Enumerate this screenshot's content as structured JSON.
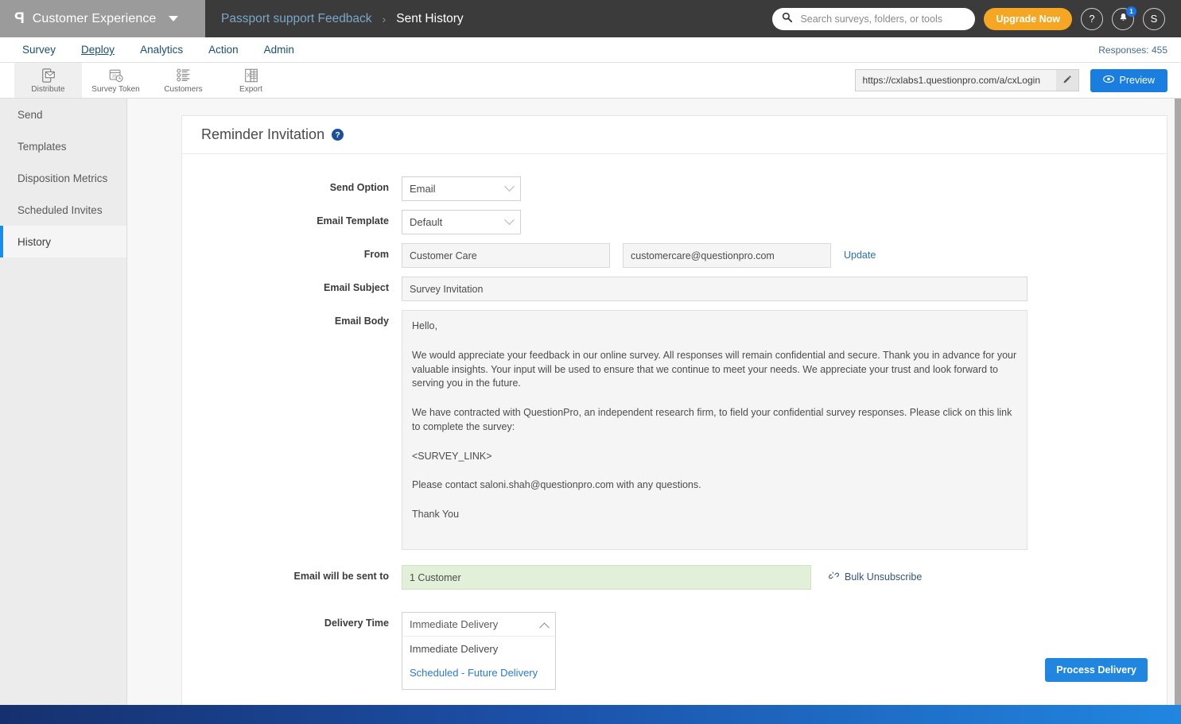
{
  "header": {
    "logo_glyph": "P",
    "brand": "Customer Experience",
    "breadcrumb_link": "Passport support Feedback",
    "breadcrumb_sep": "›",
    "breadcrumb_current": "Sent History",
    "search_placeholder": "Search surveys, folders, or tools",
    "search_value": "",
    "upgrade_label": "Upgrade Now",
    "help_glyph": "?",
    "notification_count": "1",
    "avatar_initial": "S"
  },
  "nav": {
    "items": [
      {
        "label": "Survey",
        "active": false
      },
      {
        "label": "Deploy",
        "active": true
      },
      {
        "label": "Analytics",
        "active": false
      },
      {
        "label": "Action",
        "active": false
      },
      {
        "label": "Admin",
        "active": false
      }
    ],
    "responses": "Responses: 455"
  },
  "toolbar": {
    "tools": [
      {
        "label": "Distribute",
        "icon": "distribute-icon",
        "active": true
      },
      {
        "label": "Survey Token",
        "icon": "calendar-token-icon",
        "active": false
      },
      {
        "label": "Customers",
        "icon": "customers-list-icon",
        "active": false
      },
      {
        "label": "Export",
        "icon": "excel-export-icon",
        "active": false
      }
    ],
    "url_value": "https://cxlabs1.questionpro.com/a/cxLogin",
    "edit_icon": "pencil-icon",
    "preview_label": "Preview",
    "preview_icon": "eye-icon"
  },
  "sidebar": {
    "items": [
      {
        "label": "Send",
        "active": false
      },
      {
        "label": "Templates",
        "active": false
      },
      {
        "label": "Disposition Metrics",
        "active": false
      },
      {
        "label": "Scheduled Invites",
        "active": false
      },
      {
        "label": "History",
        "active": true
      }
    ]
  },
  "card": {
    "title": "Reminder Invitation",
    "help_glyph": "?",
    "labels": {
      "send_option": "Send Option",
      "email_template": "Email Template",
      "from": "From",
      "email_subject": "Email Subject",
      "email_body": "Email Body",
      "email_will_be_sent_to": "Email will be sent to",
      "delivery_time": "Delivery Time"
    },
    "send_option_value": "Email",
    "email_template_value": "Default",
    "from_name": "Customer Care",
    "from_email": "customercare@questionpro.com",
    "update_link": "Update",
    "email_subject_value": "Survey Invitation",
    "email_body_paragraphs": [
      "Hello,",
      "We would appreciate your feedback in our online survey. All responses will remain confidential and secure. Thank you in advance for your valuable insights. Your input will be used to ensure that we continue to meet your needs. We appreciate your trust and look forward to serving you in the future.",
      "We have contracted with QuestionPro, an independent research firm, to field your confidential survey responses. Please click on this link to complete the survey:",
      "<SURVEY_LINK>",
      "Please contact saloni.shah@questionpro.com with any questions.",
      "Thank You"
    ],
    "sent_to_value": "1 Customer",
    "bulk_unsubscribe": "Bulk Unsubscribe",
    "bulk_unsubscribe_icon": "broken-link-icon",
    "delivery_time_selected": "Immediate Delivery",
    "delivery_time_options": [
      {
        "label": "Immediate Delivery",
        "highlight": false
      },
      {
        "label": "Scheduled - Future Delivery",
        "highlight": true
      }
    ],
    "process_button": "Process Delivery"
  },
  "colors": {
    "accent_blue": "#2186e0",
    "upgrade_orange": "#f5a623",
    "sidebar_active": "#1a8cf0",
    "success_green": "#e2f0d9",
    "header_dark": "#3b3b3b"
  }
}
